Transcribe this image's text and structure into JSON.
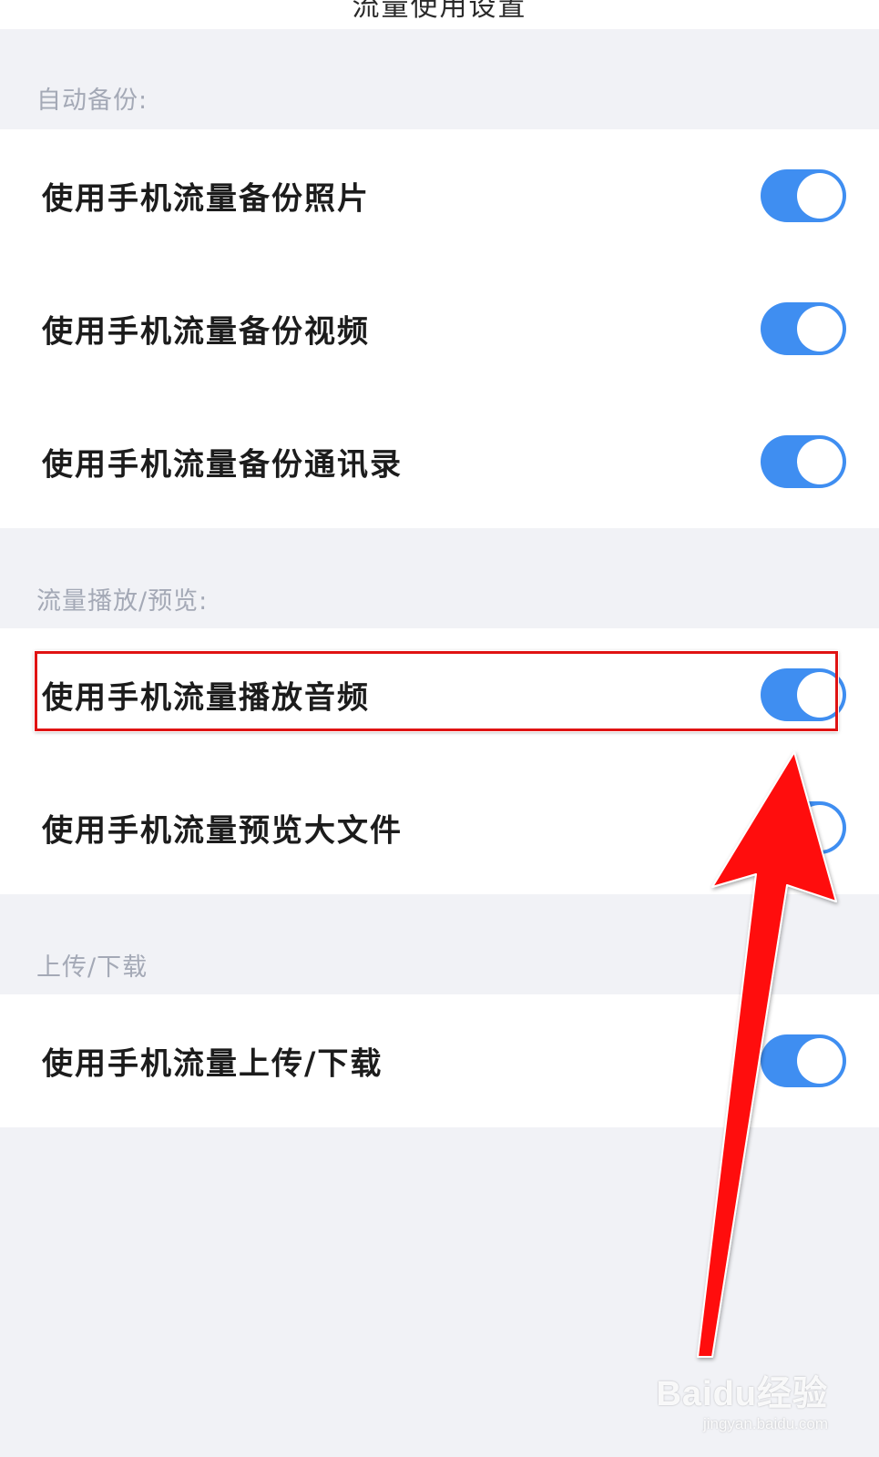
{
  "header": {
    "partial_title": "流量使用设置"
  },
  "sections": [
    {
      "header": "自动备份:",
      "items": [
        {
          "label": "使用手机流量备份照片",
          "on": true
        },
        {
          "label": "使用手机流量备份视频",
          "on": true
        },
        {
          "label": "使用手机流量备份通讯录",
          "on": true
        }
      ]
    },
    {
      "header": "流量播放/预览:",
      "items": [
        {
          "label": "使用手机流量播放音频",
          "on": true
        },
        {
          "label": "使用手机流量预览大文件",
          "on": true
        }
      ]
    },
    {
      "header": "上传/下载",
      "items": [
        {
          "label": "使用手机流量上传/下载",
          "on": true
        }
      ]
    }
  ],
  "colors": {
    "toggle_on": "#3f8ef1",
    "page_background": "#f1f2f6",
    "annotation_red": "#e01313"
  },
  "watermark": {
    "logo": "Baidu经验",
    "url": "jingyan.baidu.com"
  }
}
